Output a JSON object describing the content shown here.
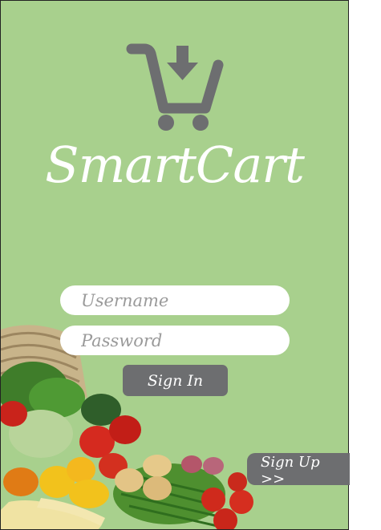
{
  "app": {
    "title": "SmartCart"
  },
  "login": {
    "username_placeholder": "Username",
    "password_placeholder": "Password",
    "signin_label": "Sign In",
    "signup_label": "Sign Up >>"
  },
  "colors": {
    "background": "#a8d08d",
    "button": "#6d6e70",
    "logo": "#6d6e70",
    "title": "#ffffff"
  },
  "icons": {
    "logo": "cart-download-icon",
    "decoration": "vegetable-basket"
  }
}
